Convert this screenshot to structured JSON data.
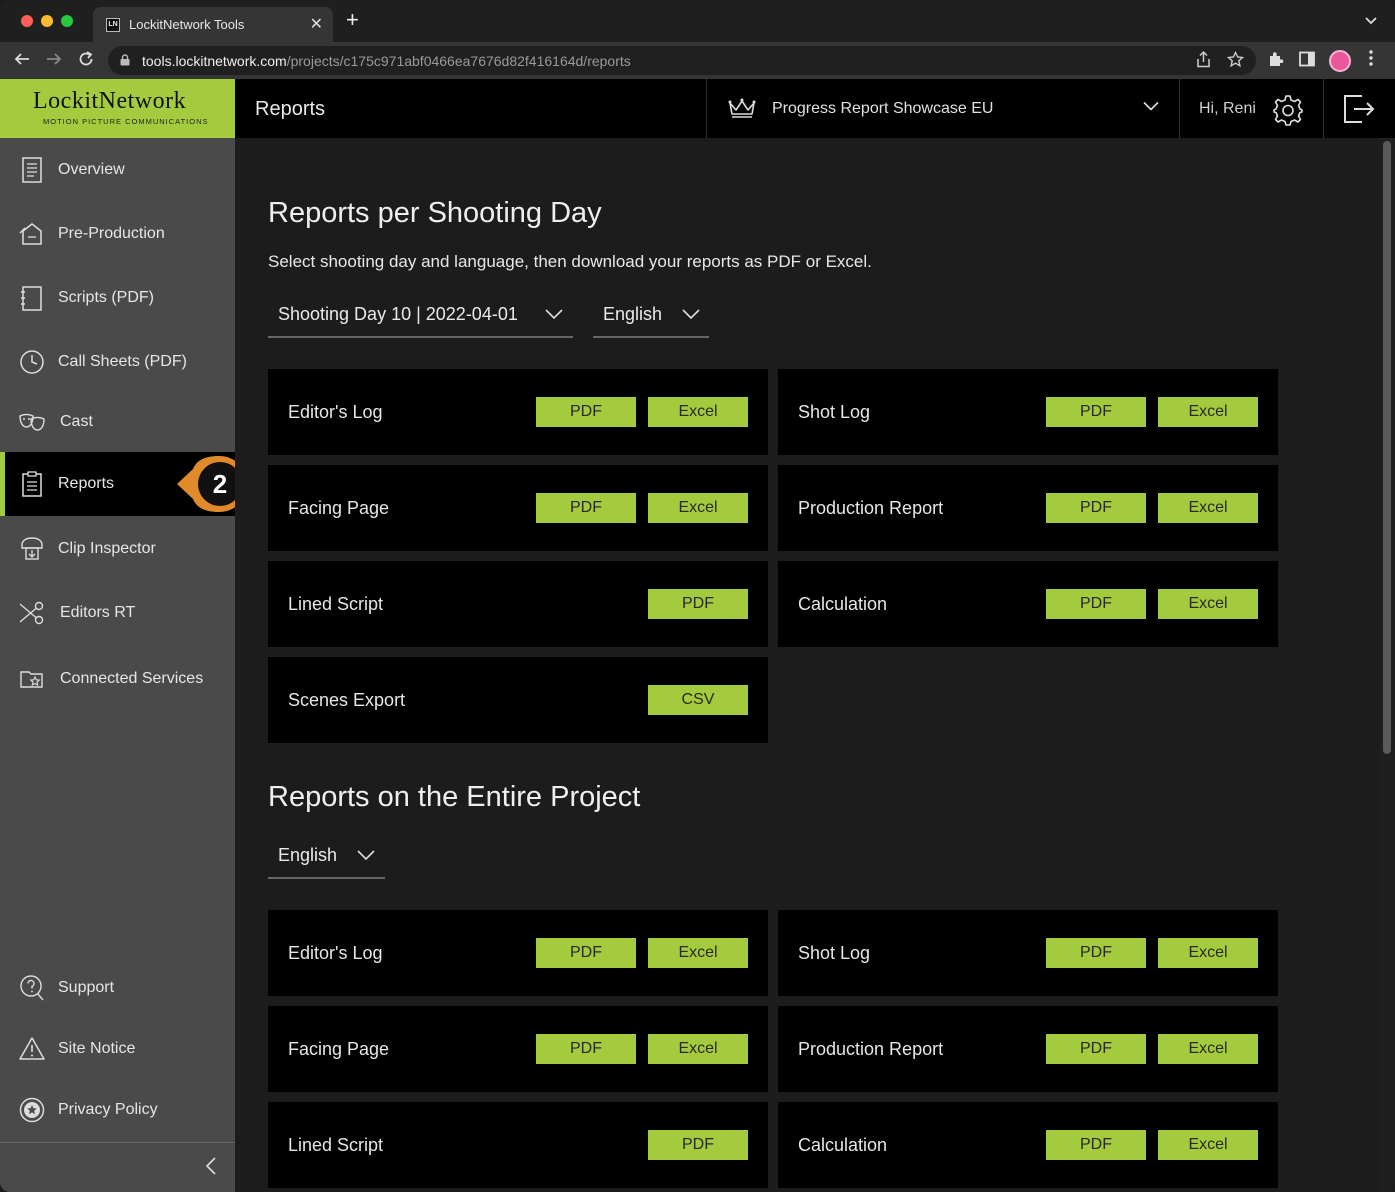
{
  "browser": {
    "tab_title": "LockitNetwork Tools",
    "tab_favicon": "LN",
    "url_host": "tools.lockitnetwork.com",
    "url_path": "/projects/c175c971abf0466ea7676d82f416164d/reports"
  },
  "app": {
    "logo": "LockitNetwork",
    "logo_sub": "MOTION PICTURE COMMUNICATIONS",
    "header_title": "Reports",
    "project": "Progress Report Showcase EU",
    "greeting": "Hi, Reni",
    "accent": "#a4cb3d"
  },
  "sidebar": {
    "items": [
      {
        "label": "Overview",
        "icon": "document-icon"
      },
      {
        "label": "Pre-Production",
        "icon": "preproduction-icon"
      },
      {
        "label": "Scripts (PDF)",
        "icon": "script-icon"
      },
      {
        "label": "Call Sheets (PDF)",
        "icon": "clock-icon"
      },
      {
        "label": "Cast",
        "icon": "masks-icon"
      },
      {
        "label": "Reports",
        "icon": "clipboard-icon",
        "active": true
      },
      {
        "label": "Clip Inspector",
        "icon": "clip-icon"
      },
      {
        "label": "Editors RT",
        "icon": "scissors-icon"
      },
      {
        "label": "Connected Services",
        "icon": "folder-star-icon"
      }
    ],
    "bottom_items": [
      {
        "label": "Support",
        "icon": "support-icon"
      },
      {
        "label": "Site Notice",
        "icon": "warning-icon"
      },
      {
        "label": "Privacy Policy",
        "icon": "privacy-icon"
      }
    ],
    "step_badge": "2"
  },
  "per_day": {
    "title": "Reports per Shooting Day",
    "description": "Select shooting day and language, then download your reports as PDF or Excel.",
    "day_select": "Shooting Day 10 | 2022-04-01",
    "language_select": "English",
    "cards": [
      {
        "title": "Editor's Log",
        "b1": "PDF",
        "b2": "Excel"
      },
      {
        "title": "Shot Log",
        "b1": "PDF",
        "b2": "Excel"
      },
      {
        "title": "Facing Page",
        "b1": "PDF",
        "b2": "Excel"
      },
      {
        "title": "Production Report",
        "b1": "PDF",
        "b2": "Excel"
      },
      {
        "title": "Lined Script",
        "b2": "PDF"
      },
      {
        "title": "Calculation",
        "b1": "PDF",
        "b2": "Excel"
      },
      {
        "title": "Scenes Export",
        "b2": "CSV"
      }
    ]
  },
  "project": {
    "title": "Reports on the Entire Project",
    "language_select": "English",
    "cards": [
      {
        "title": "Editor's Log",
        "b1": "PDF",
        "b2": "Excel"
      },
      {
        "title": "Shot Log",
        "b1": "PDF",
        "b2": "Excel"
      },
      {
        "title": "Facing Page",
        "b1": "PDF",
        "b2": "Excel"
      },
      {
        "title": "Production Report",
        "b1": "PDF",
        "b2": "Excel"
      },
      {
        "title": "Lined Script",
        "b2": "PDF"
      },
      {
        "title": "Calculation",
        "b1": "PDF",
        "b2": "Excel"
      }
    ]
  }
}
